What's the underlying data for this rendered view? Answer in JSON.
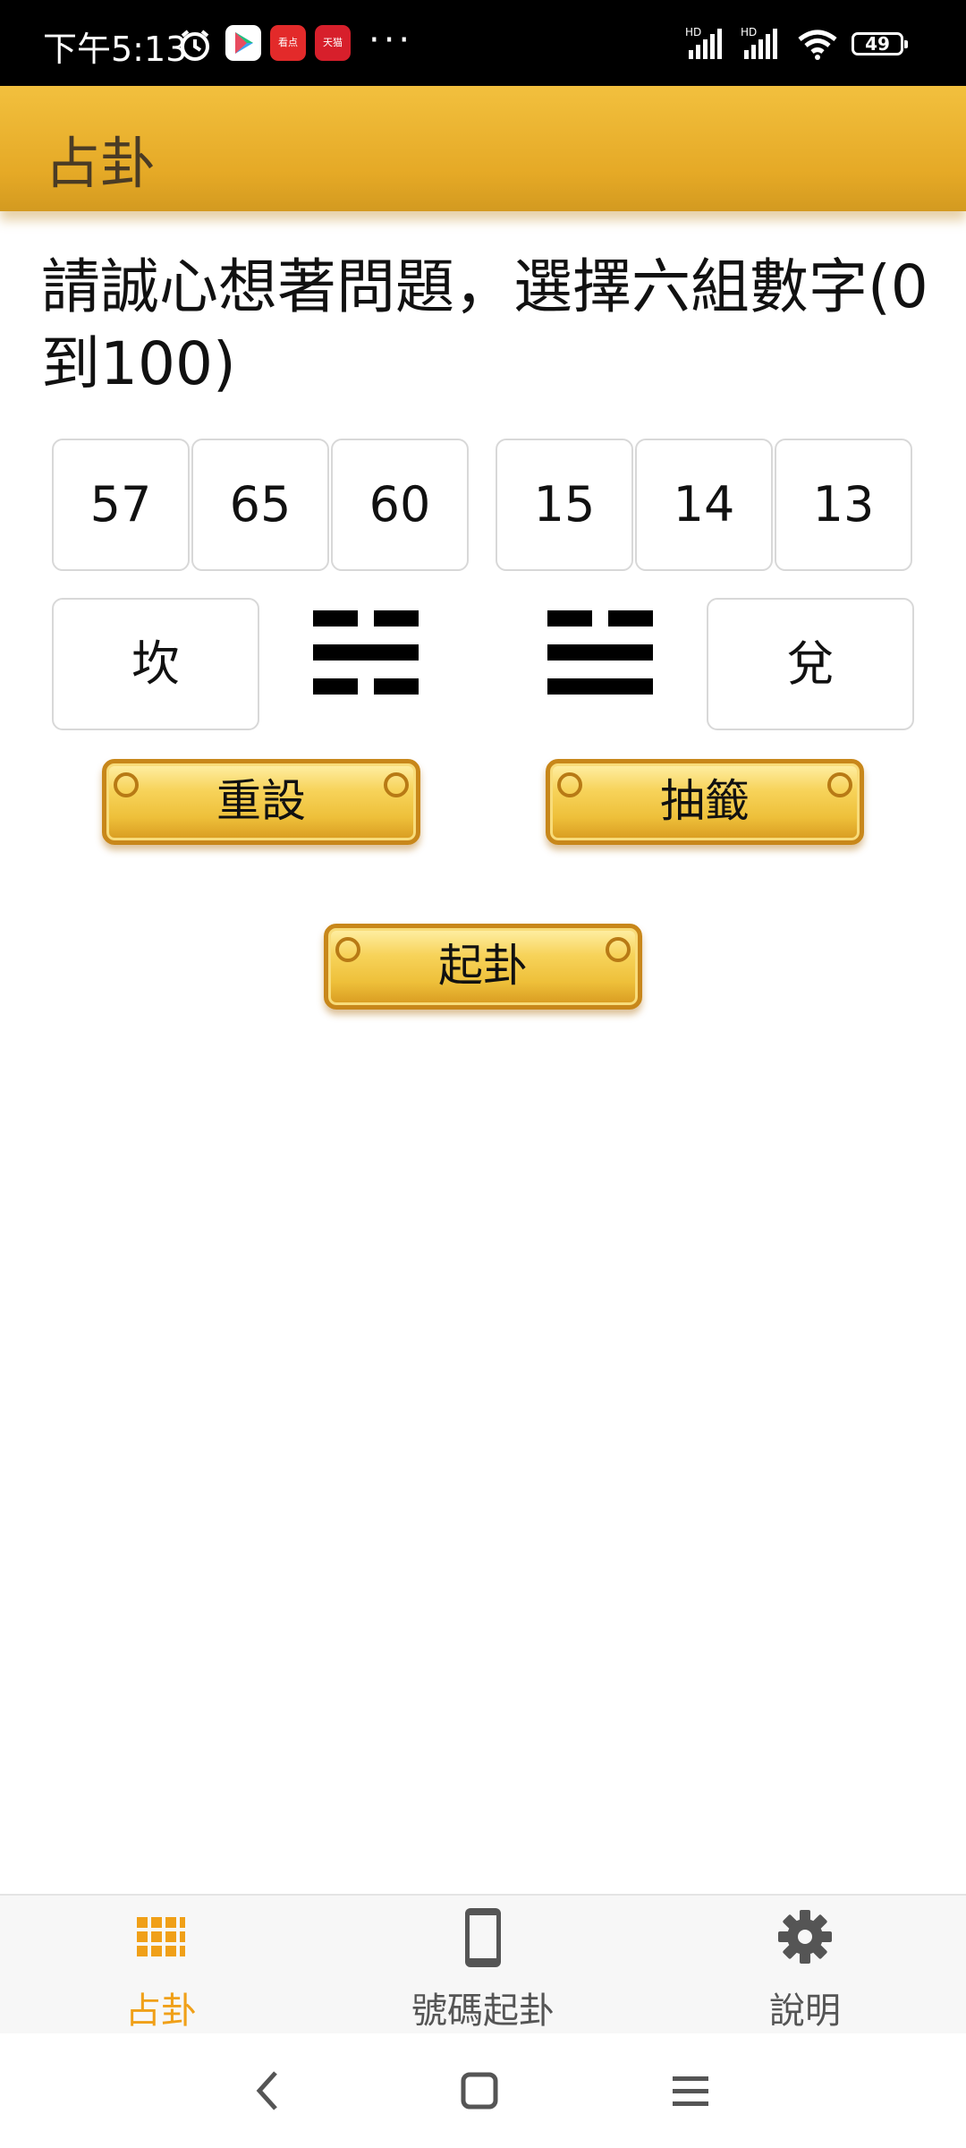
{
  "status_bar": {
    "time": "下午5:13",
    "battery": "49",
    "app_icon_1": "看点",
    "app_icon_2": "天猫"
  },
  "app_bar": {
    "title": "占卦"
  },
  "prompt": "請誠心想著問題，選擇六組數字(0到100)",
  "numbers": [
    "57",
    "65",
    "60",
    "15",
    "14",
    "13"
  ],
  "trigrams": {
    "left_name": "坎",
    "right_name": "兌",
    "left_icon": "kan-trigram-icon",
    "right_icon": "dui-trigram-icon"
  },
  "buttons": {
    "reset": "重設",
    "draw": "抽籤",
    "cast": "起卦"
  },
  "bottom_nav": {
    "items": [
      {
        "label": "占卦",
        "icon": "grid-icon",
        "active": true
      },
      {
        "label": "號碼起卦",
        "icon": "phone-icon",
        "active": false
      },
      {
        "label": "說明",
        "icon": "gear-icon",
        "active": false
      }
    ],
    "active_color": "#f0a018",
    "inactive_color": "#555555"
  },
  "colors": {
    "app_bar": "#e5a926",
    "button_gold": "#f7d35a"
  }
}
